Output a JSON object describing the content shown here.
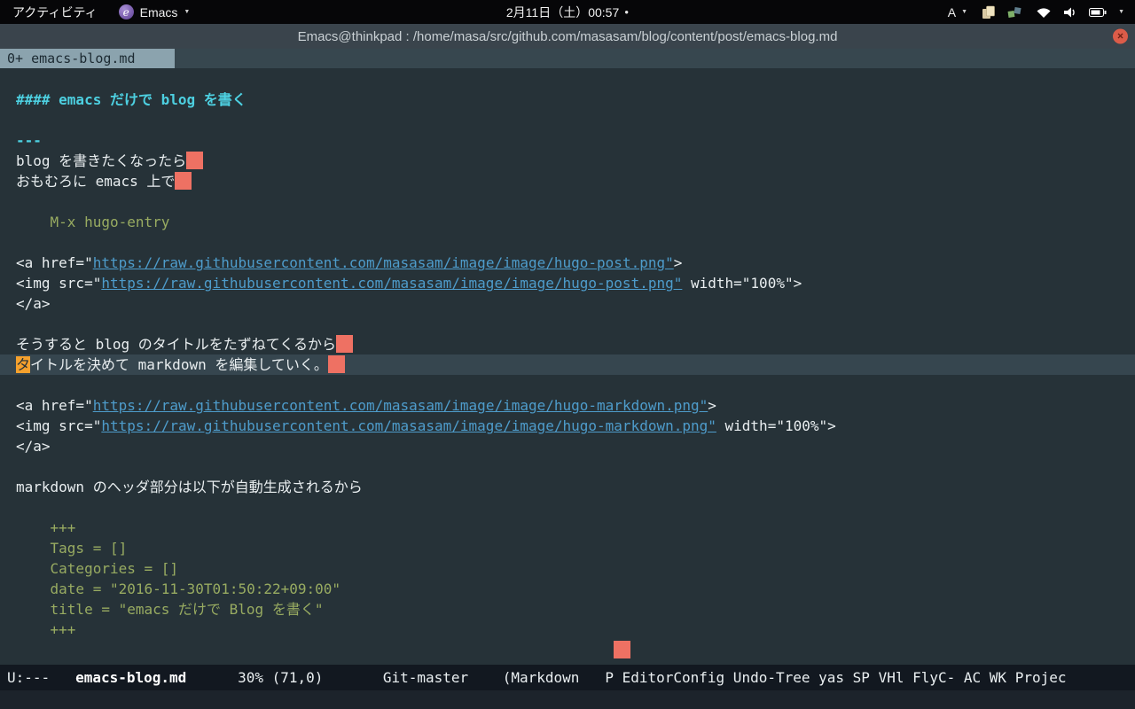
{
  "colors": {
    "buffer_bg": "#263238",
    "buffer_fg": "#e9eef0",
    "heading_cyan": "#4dd0e1",
    "code_green": "#98ab61",
    "link_blue": "#4e9ccb",
    "trailing_whitespace": "#ee7163",
    "cursor_orange": "#f5a12d",
    "hl_line": "#36464f",
    "tab_selected_bg": "#8ba3ae",
    "mode_line_bg": "#121820",
    "close_button": "#dc5c49"
  },
  "top_bar": {
    "activities_label": "アクティビティ",
    "app_name": "Emacs",
    "emacs_badge_glyph": "e",
    "clock": "2月11日（土）00:57",
    "notification_dot": "●",
    "input_method_label": "A",
    "caret_glyph": "▼"
  },
  "title_bar": {
    "title": "Emacs@thinkpad : /home/masa/src/github.com/masasam/blog/content/post/emacs-blog.md",
    "close_glyph": "×"
  },
  "tab_bar": {
    "selected_tab": "0+ emacs-blog.md"
  },
  "buffer": {
    "lines": [
      {
        "segs": [
          {
            "t": "#### emacs だけで blog を書く",
            "s": "heading"
          }
        ]
      },
      {
        "segs": []
      },
      {
        "segs": [
          {
            "t": "---",
            "s": "heading"
          }
        ]
      },
      {
        "segs": [
          {
            "t": "blog を書きたくなったら",
            "s": "plain"
          },
          {
            "t": "",
            "s": "trail"
          }
        ]
      },
      {
        "segs": [
          {
            "t": "おもむろに emacs 上で",
            "s": "plain"
          },
          {
            "t": "",
            "s": "trail"
          }
        ]
      },
      {
        "segs": []
      },
      {
        "segs": [
          {
            "t": "    M-x hugo-entry",
            "s": "code"
          }
        ]
      },
      {
        "segs": []
      },
      {
        "segs": [
          {
            "t": "<a href=\"",
            "s": "plain"
          },
          {
            "t": "https://raw.githubusercontent.com/masasam/image/image/hugo-post.png\"",
            "s": "link"
          },
          {
            "t": ">",
            "s": "plain"
          }
        ]
      },
      {
        "segs": [
          {
            "t": "<img src=\"",
            "s": "plain"
          },
          {
            "t": "https://raw.githubusercontent.com/masasam/image/image/hugo-post.png\"",
            "s": "link"
          },
          {
            "t": " width=\"100%\">",
            "s": "plain"
          }
        ]
      },
      {
        "segs": [
          {
            "t": "</a>",
            "s": "plain"
          }
        ]
      },
      {
        "segs": []
      },
      {
        "segs": [
          {
            "t": "そうすると blog のタイトルをたずねてくるから",
            "s": "plain"
          },
          {
            "t": "",
            "s": "trail"
          }
        ]
      },
      {
        "hl": true,
        "segs": [
          {
            "t": "タ",
            "s": "cursor"
          },
          {
            "t": "イトルを決めて markdown を編集していく。",
            "s": "plain"
          },
          {
            "t": "",
            "s": "trail"
          }
        ]
      },
      {
        "segs": []
      },
      {
        "segs": [
          {
            "t": "<a href=\"",
            "s": "plain"
          },
          {
            "t": "https://raw.githubusercontent.com/masasam/image/image/hugo-markdown.png\"",
            "s": "link"
          },
          {
            "t": ">",
            "s": "plain"
          }
        ]
      },
      {
        "segs": [
          {
            "t": "<img src=\"",
            "s": "plain"
          },
          {
            "t": "https://raw.githubusercontent.com/masasam/image/image/hugo-markdown.png\"",
            "s": "link"
          },
          {
            "t": " width=\"100%\">",
            "s": "plain"
          }
        ]
      },
      {
        "segs": [
          {
            "t": "</a>",
            "s": "plain"
          }
        ]
      },
      {
        "segs": []
      },
      {
        "segs": [
          {
            "t": "markdown のヘッダ部分は以下が自動生成されるから",
            "s": "plain"
          }
        ]
      },
      {
        "segs": []
      },
      {
        "segs": [
          {
            "t": "    +++",
            "s": "code"
          }
        ]
      },
      {
        "segs": [
          {
            "t": "    Tags = []",
            "s": "code"
          }
        ]
      },
      {
        "segs": [
          {
            "t": "    Categories = []",
            "s": "code"
          }
        ]
      },
      {
        "segs": [
          {
            "t": "    date = \"2016-11-30T01:50:22+09:00\"",
            "s": "code"
          }
        ]
      },
      {
        "segs": [
          {
            "t": "    title = \"emacs だけで Blog を書く\"",
            "s": "code"
          }
        ]
      },
      {
        "segs": [
          {
            "t": "    +++",
            "s": "code"
          }
        ]
      },
      {
        "segs": [
          {
            "t": "                                                                      ",
            "s": "plain"
          },
          {
            "t": "",
            "s": "trail"
          }
        ]
      }
    ]
  },
  "mode_line": {
    "read_only_indicator": "U:---",
    "buffer_name": "emacs-blog.md",
    "scroll_percent": "30%",
    "position": "(71,0)",
    "vc_branch": "Git-master",
    "major_mode": "Markdown",
    "minor_modes": "P EditorConfig Undo-Tree yas SP VHl FlyC- AC WK Projec",
    "lines": [
      {
        "segs": [
          {
            "t": "U:---   ",
            "s": "plain"
          },
          {
            "t": "emacs-blog.md",
            "s": "bold"
          },
          {
            "t": "      30% (71,0)       Git-master    (Markdown   ",
            "s": "plain"
          },
          {
            "t": "P EditorConfig Undo-Tree yas SP VHl FlyC- AC WK Projec",
            "s": "plain"
          }
        ]
      }
    ]
  }
}
